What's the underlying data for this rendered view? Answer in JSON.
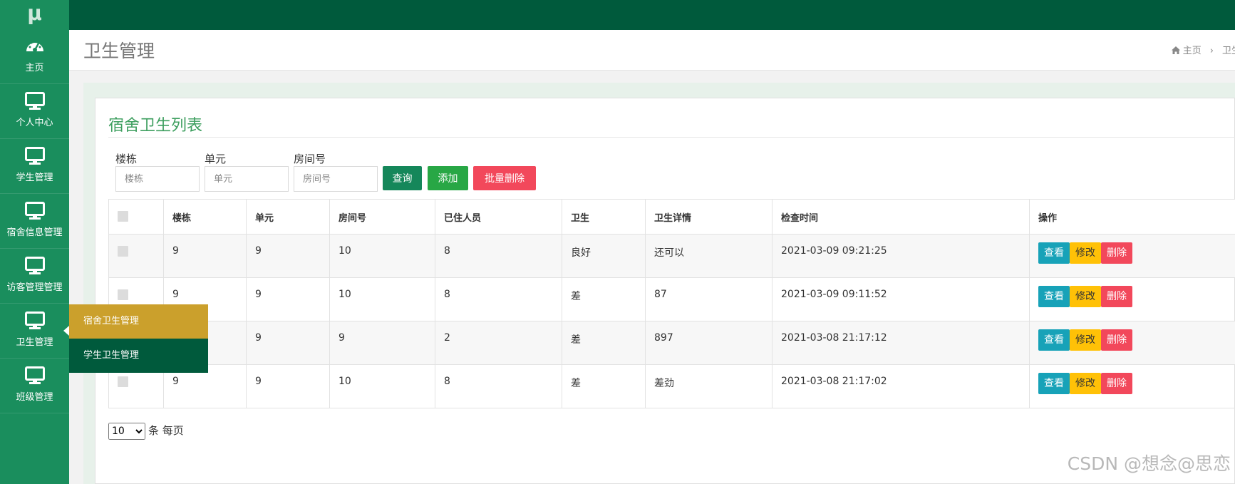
{
  "app": {
    "logo": "μ"
  },
  "sidebar": {
    "items": [
      {
        "label": "主页",
        "icon": "dashboard-icon"
      },
      {
        "label": "个人中心",
        "icon": "monitor-icon"
      },
      {
        "label": "学生管理",
        "icon": "monitor-icon"
      },
      {
        "label": "宿舍信息管理",
        "icon": "monitor-icon"
      },
      {
        "label": "访客管理管理",
        "icon": "monitor-icon"
      },
      {
        "label": "卫生管理",
        "icon": "monitor-icon",
        "active": true
      },
      {
        "label": "班级管理",
        "icon": "monitor-icon"
      }
    ],
    "flyout": [
      {
        "label": "宿舍卫生管理"
      },
      {
        "label": "学生卫生管理"
      }
    ]
  },
  "header": {
    "title": "卫生管理",
    "breadcrumb": {
      "home": "主页",
      "current": "卫生"
    }
  },
  "card": {
    "title": "宿舍卫生列表"
  },
  "search": {
    "building": {
      "label": "楼栋",
      "placeholder": "楼栋"
    },
    "unit": {
      "label": "单元",
      "placeholder": "单元"
    },
    "room": {
      "label": "房间号",
      "placeholder": "房间号"
    },
    "query_label": "查询",
    "add_label": "添加",
    "batch_delete_label": "批量删除"
  },
  "table": {
    "columns": [
      "楼栋",
      "单元",
      "房间号",
      "已住人员",
      "卫生",
      "卫生详情",
      "检查时间",
      "操作"
    ],
    "rows": [
      {
        "building": "9",
        "unit": "9",
        "room": "10",
        "residents": "8",
        "hygiene": "良好",
        "detail": "还可以",
        "time": "2021-03-09 09:21:25"
      },
      {
        "building": "9",
        "unit": "9",
        "room": "10",
        "residents": "8",
        "hygiene": "差",
        "detail": "87",
        "time": "2021-03-09 09:11:52"
      },
      {
        "building": "",
        "unit": "9",
        "room": "9",
        "residents": "2",
        "hygiene": "差",
        "detail": "897",
        "time": "2021-03-08 21:17:12"
      },
      {
        "building": "9",
        "unit": "9",
        "room": "10",
        "residents": "8",
        "hygiene": "差",
        "detail": "差劲",
        "time": "2021-03-08 21:17:02"
      }
    ],
    "actions": {
      "view": "查看",
      "edit": "修改",
      "delete": "删除"
    }
  },
  "pager": {
    "page_size": "10",
    "suffix": "条 每页"
  },
  "watermark": "CSDN @想念@思恋",
  "colors": {
    "sidebar": "#1a8e5d",
    "topbar": "#005a3c",
    "flyout_active": "#cba02c",
    "accent_title": "#3e9f5f"
  }
}
